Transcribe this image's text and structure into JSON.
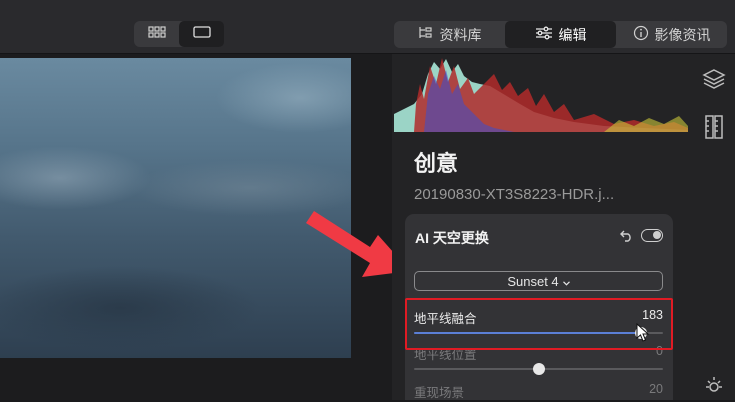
{
  "toolbar": {
    "view_grid_icon": "grid-icon",
    "view_single_icon": "single-view-icon",
    "tabs": [
      {
        "label": "资料库",
        "icon": "library-icon"
      },
      {
        "label": "编辑",
        "icon": "sliders-icon"
      },
      {
        "label": "影像资讯",
        "icon": "info-icon"
      }
    ],
    "active_tab": "编辑"
  },
  "panel": {
    "section_title": "创意",
    "filename": "20190830-XT3S8223-HDR.j...",
    "rail_icons": [
      "layers-icon",
      "ruler-icon",
      "sun-icon"
    ]
  },
  "sky_card": {
    "title": "AI 天空更换",
    "dropdown_value": "Sunset 4",
    "sliders": [
      {
        "label": "地平线融合",
        "value": "183",
        "fraction": 0.91,
        "active": true
      },
      {
        "label": "地平线位置",
        "value": "0",
        "fraction": 0.5,
        "active": false
      },
      {
        "label": "重现场景",
        "value": "20",
        "fraction": 0.2,
        "active": false
      }
    ]
  },
  "colors": {
    "accent_slider": "#5b7fd6",
    "highlight_border": "#e01b24",
    "arrow": "#f03a44"
  }
}
